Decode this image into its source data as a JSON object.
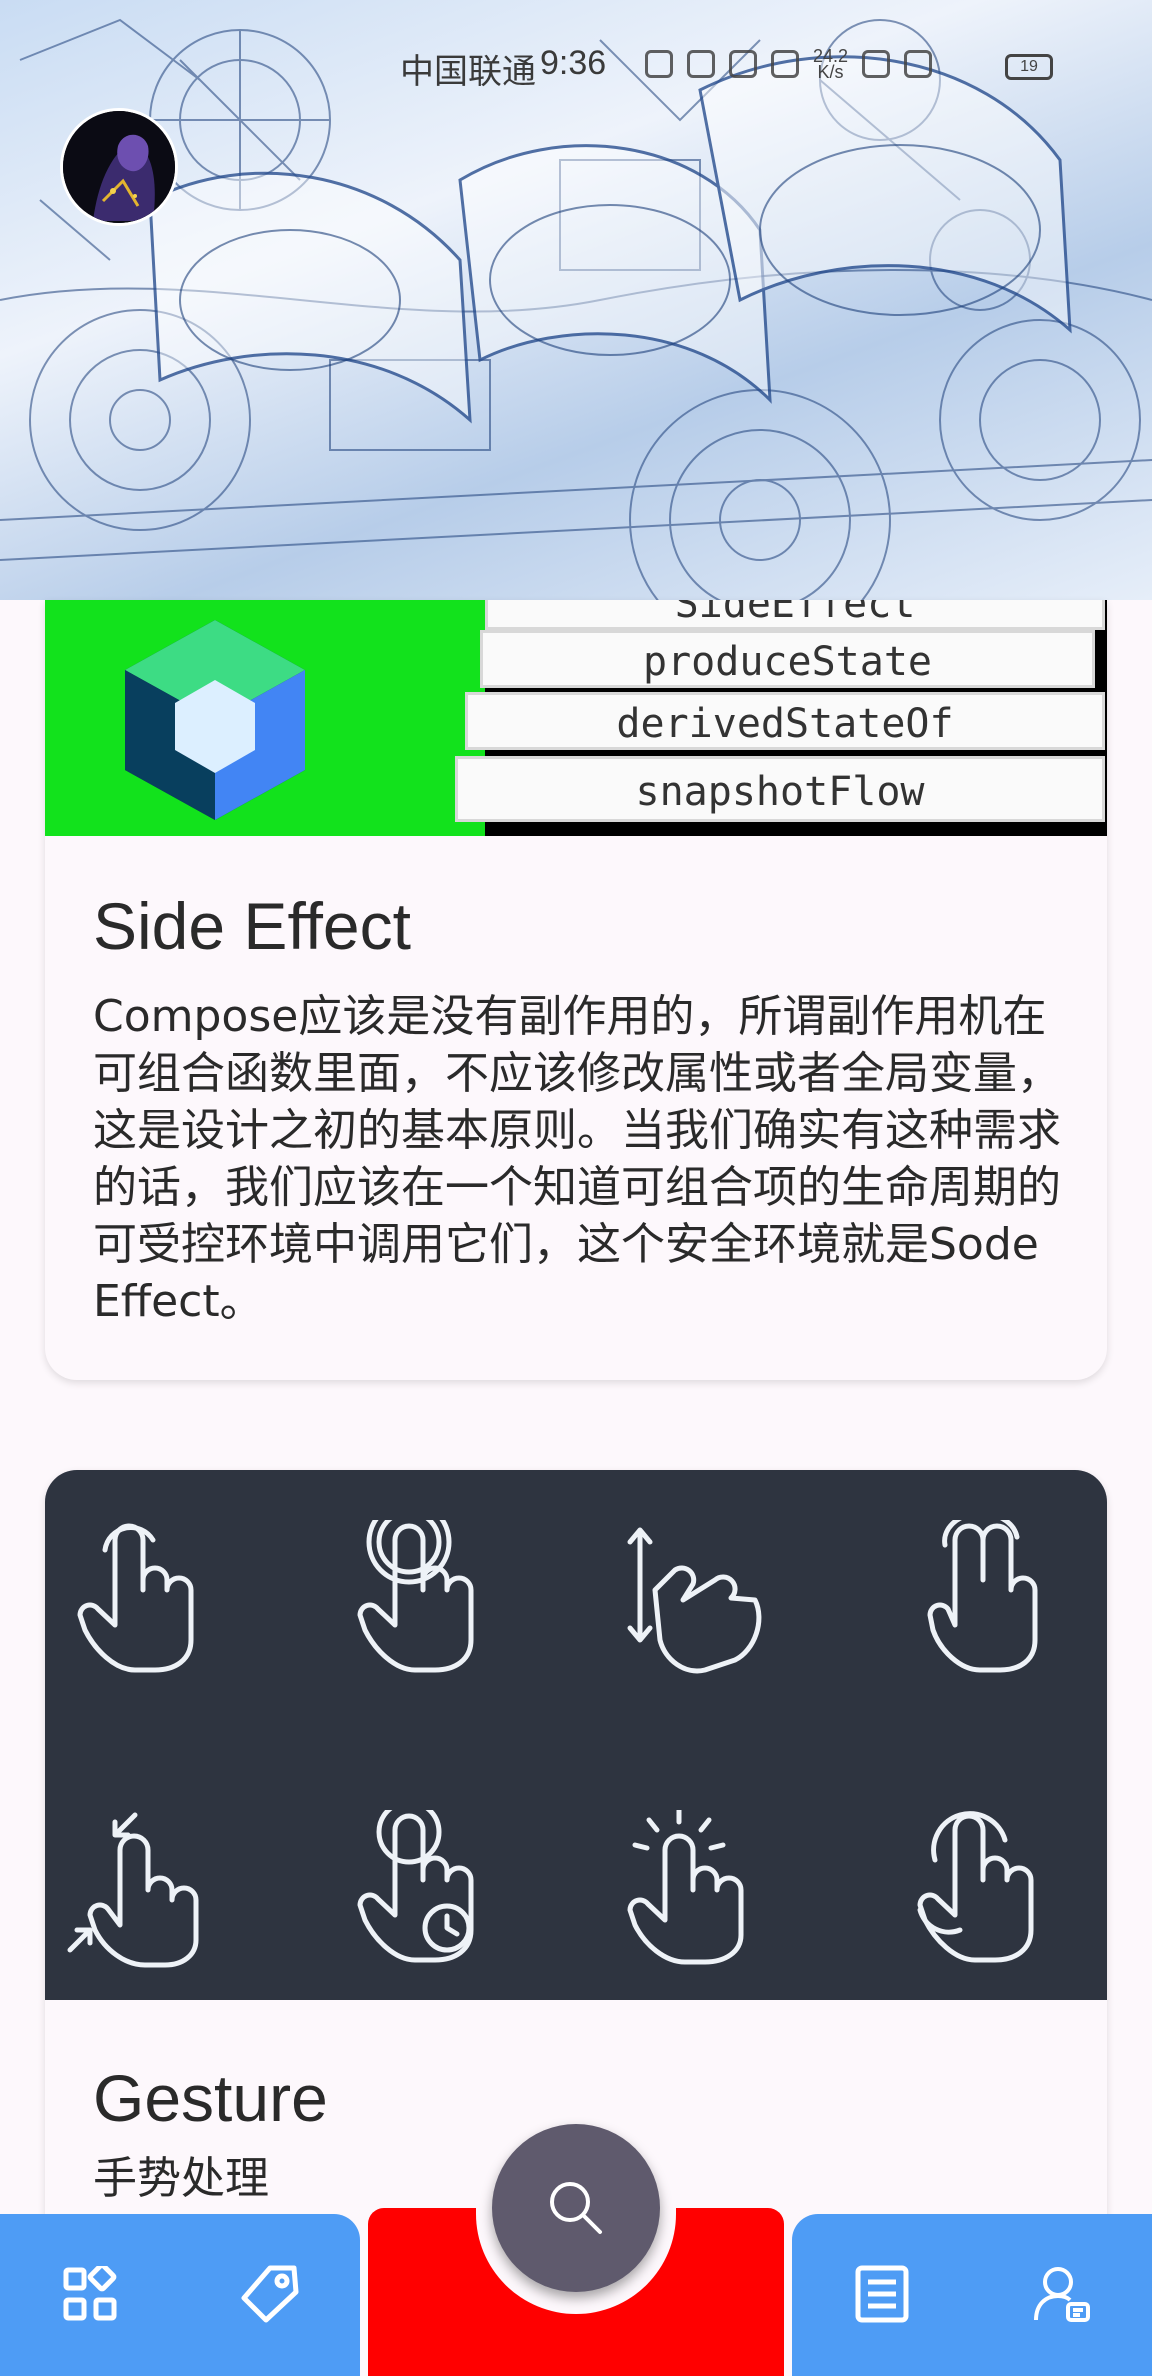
{
  "status_bar": {
    "carrier": "中国联通",
    "time": "9:36",
    "net_speed": "24.2\nK/s",
    "battery": "19"
  },
  "cards": [
    {
      "image_tags": [
        "SideEffect",
        "produceState",
        "derivedStateOf",
        "snapshotFlow"
      ],
      "title": "Side Effect",
      "body": "Compose应该是没有副作用的，所谓副作用机在可组合函数里面，不应该修改属性或者全局变量，这是设计之初的基本原则。当我们确实有这种需求的话，我们应该在一个知道可组合项的生命周期的可受控环境中调用它们，这个安全环境就是Sode Effect。"
    },
    {
      "title": "Gesture",
      "body": "手势处理",
      "gesture_icons": [
        "tap-icon",
        "double-tap-icon",
        "vertical-swipe-icon",
        "two-finger-tap-icon",
        "pinch-icon",
        "long-press-icon",
        "press-icon",
        "rotate-icon"
      ]
    }
  ],
  "bottom_nav": {
    "items": [
      "grid-icon",
      "tag-icon",
      "search-icon",
      "article-icon",
      "profile-icon"
    ]
  },
  "colors": {
    "nav_blue": "#4e9cf5",
    "nav_center": "#ff0000",
    "fab": "#5f5a6d",
    "gesture_panel": "#2e3440",
    "card_bg": "#fdf8fc"
  }
}
